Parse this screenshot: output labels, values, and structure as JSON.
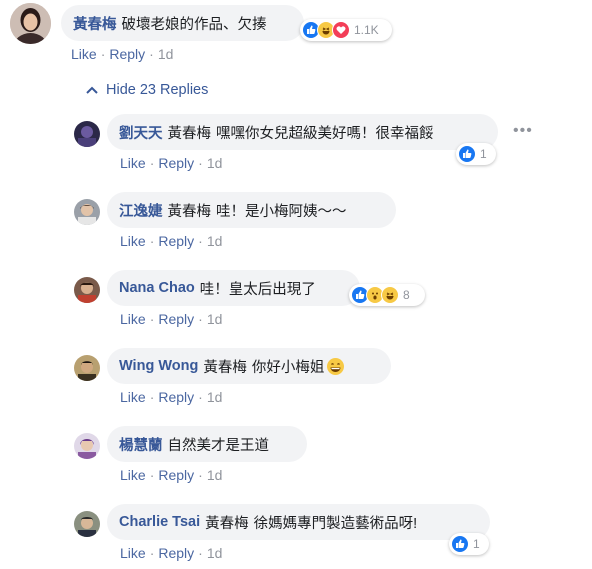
{
  "main_comment": {
    "author": "黃春梅",
    "text": "破壞老娘的作品、欠揍",
    "reaction_count": "1.1K",
    "reactions": [
      "like-icon",
      "haha-icon",
      "love-icon"
    ],
    "actions": {
      "like": "Like",
      "reply": "Reply",
      "time": "1d"
    }
  },
  "hide_replies_label": "Hide 23 Replies",
  "replies": [
    {
      "author": "劉天天",
      "mention": "黃春梅",
      "text": "嘿嘿你女兒超級美好嗎！很幸福餒",
      "reaction_count": "1",
      "like": "Like",
      "reply": "Reply",
      "time": "1d"
    },
    {
      "author": "江逸婕",
      "mention": "黃春梅",
      "text": "哇！是小梅阿姨～～",
      "like": "Like",
      "reply": "Reply",
      "time": "1d"
    },
    {
      "author": "Nana Chao",
      "mention": "",
      "text": "哇！皇太后出現了",
      "reaction_count": "8",
      "like": "Like",
      "reply": "Reply",
      "time": "1d"
    },
    {
      "author": "Wing Wong",
      "mention": "黃春梅",
      "text": "你好小梅姐",
      "like": "Like",
      "reply": "Reply",
      "time": "1d"
    },
    {
      "author": "楊慧蘭",
      "mention": "",
      "text": "自然美才是王道",
      "like": "Like",
      "reply": "Reply",
      "time": "1d"
    },
    {
      "author": "Charlie Tsai",
      "mention": "黃春梅",
      "text": "徐媽媽專門製造藝術品呀!",
      "reaction_count": "1",
      "like": "Like",
      "reply": "Reply",
      "time": "1d"
    }
  ],
  "colors": {
    "link": "#385898",
    "bubble": "#f2f3f5",
    "meta": "#90949c",
    "like_blue": "#1877f2"
  }
}
